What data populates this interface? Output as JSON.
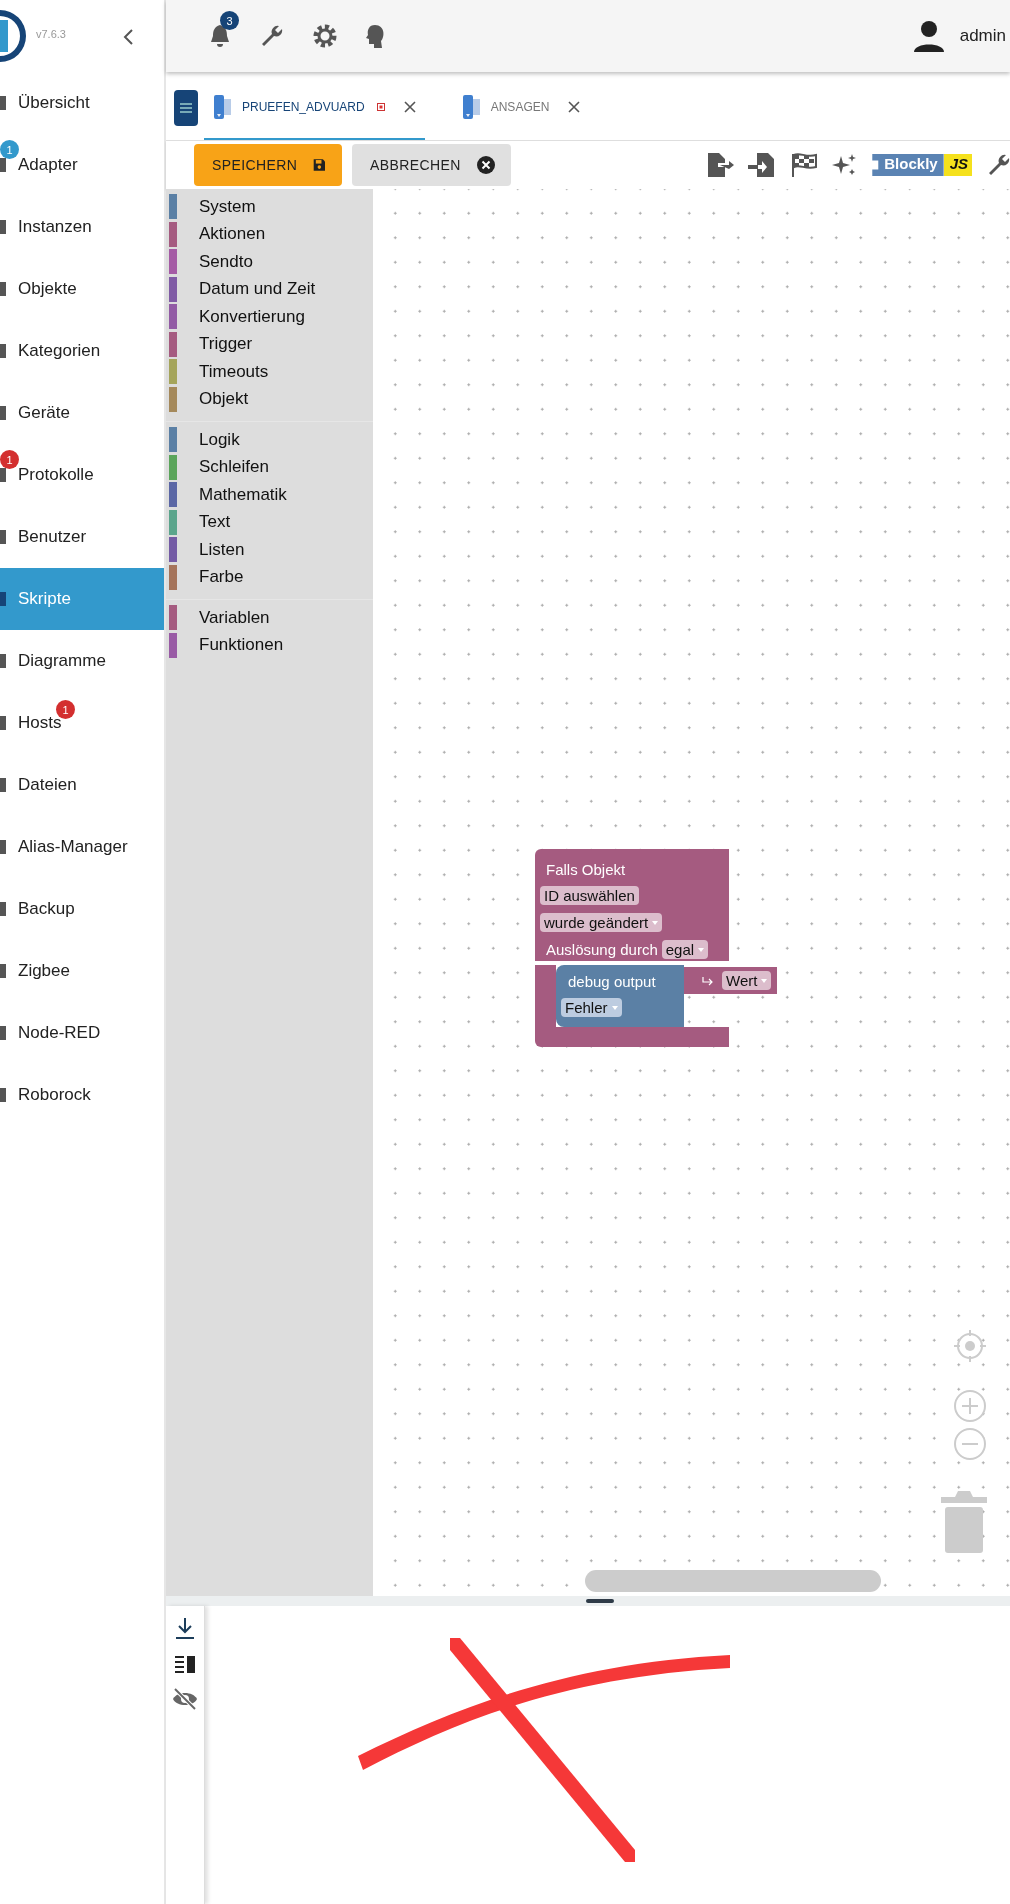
{
  "sidebar": {
    "version": "v7.6.3",
    "items": [
      {
        "label": "Übersicht",
        "selected": false
      },
      {
        "label": "Adapter",
        "selected": false,
        "badge": {
          "text": "1",
          "color": "#3399cc",
          "trailing": false
        }
      },
      {
        "label": "Instanzen",
        "selected": false
      },
      {
        "label": "Objekte",
        "selected": false
      },
      {
        "label": "Kategorien",
        "selected": false
      },
      {
        "label": "Geräte",
        "selected": false
      },
      {
        "label": "Protokolle",
        "selected": false,
        "badge": {
          "text": "1",
          "color": "#d32f2f",
          "trailing": false
        }
      },
      {
        "label": "Benutzer",
        "selected": false
      },
      {
        "label": "Skripte",
        "selected": true
      },
      {
        "label": "Diagramme",
        "selected": false
      },
      {
        "label": "Hosts",
        "selected": false,
        "badge": {
          "text": "1",
          "color": "#d32f2f",
          "trailing": true
        }
      },
      {
        "label": "Dateien",
        "selected": false
      },
      {
        "label": "Alias-Manager",
        "selected": false
      },
      {
        "label": "Backup",
        "selected": false
      },
      {
        "label": "Zigbee",
        "selected": false
      },
      {
        "label": "Node-RED",
        "selected": false
      },
      {
        "label": "Roborock",
        "selected": false
      }
    ]
  },
  "top_bar": {
    "notifications": "3",
    "user": "admin"
  },
  "tabs": [
    {
      "label": "PRUEFEN_ADVUARD",
      "selected": true,
      "modified": true
    },
    {
      "label": "ANSAGEN",
      "selected": false,
      "modified": false
    }
  ],
  "toolbar": {
    "save": "SPEICHERN",
    "cancel": "ABBRECHEN",
    "mode_left": "Blockly",
    "mode_right": "JS"
  },
  "toolbox": {
    "groups": [
      [
        {
          "label": "System",
          "color": "#5b80a5"
        },
        {
          "label": "Aktionen",
          "color": "#a55b80"
        },
        {
          "label": "Sendto",
          "color": "#a55ba5"
        },
        {
          "label": "Datum und Zeit",
          "color": "#805ba5"
        },
        {
          "label": "Konvertierung",
          "color": "#925ba5"
        },
        {
          "label": "Trigger",
          "color": "#a55b80"
        },
        {
          "label": "Timeouts",
          "color": "#a5a55b"
        },
        {
          "label": "Objekt",
          "color": "#a5895b"
        }
      ],
      [
        {
          "label": "Logik",
          "color": "#5b80a5"
        },
        {
          "label": "Schleifen",
          "color": "#5ba55b"
        },
        {
          "label": "Mathematik",
          "color": "#5b67a5"
        },
        {
          "label": "Text",
          "color": "#5ba58c"
        },
        {
          "label": "Listen",
          "color": "#745ba5"
        },
        {
          "label": "Farbe",
          "color": "#a5745b"
        }
      ],
      [
        {
          "label": "Variablen",
          "color": "#a55b80"
        },
        {
          "label": "Funktionen",
          "color": "#995ba5"
        }
      ]
    ]
  },
  "block": {
    "title": "Falls Objekt",
    "id_field": "ID auswählen",
    "event": "wurde geändert",
    "trigger_label": "Auslösung durch",
    "trigger": "egal",
    "inner": {
      "title": "debug output",
      "level": "Fehler",
      "value": "Wert"
    }
  }
}
